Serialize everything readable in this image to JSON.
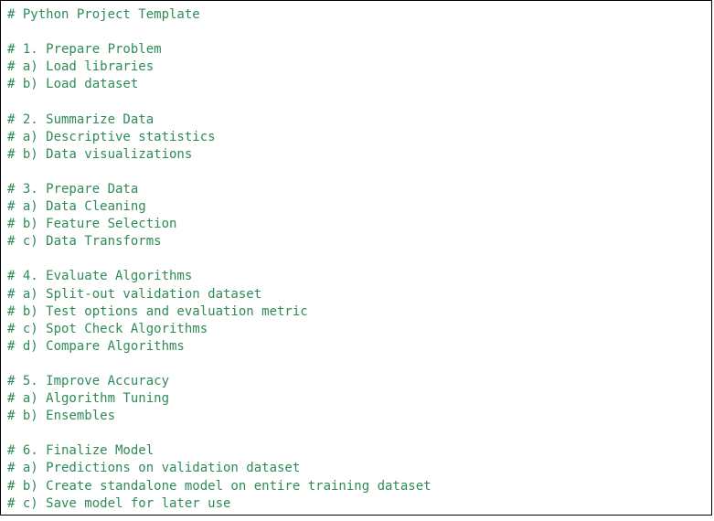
{
  "colors": {
    "comment_text": "#2e8b57",
    "border": "#000000",
    "background": "#ffffff"
  },
  "code_lines": [
    "# Python Project Template",
    "",
    "# 1. Prepare Problem",
    "# a) Load libraries",
    "# b) Load dataset",
    "",
    "# 2. Summarize Data",
    "# a) Descriptive statistics",
    "# b) Data visualizations",
    "",
    "# 3. Prepare Data",
    "# a) Data Cleaning",
    "# b) Feature Selection",
    "# c) Data Transforms",
    "",
    "# 4. Evaluate Algorithms",
    "# a) Split-out validation dataset",
    "# b) Test options and evaluation metric",
    "# c) Spot Check Algorithms",
    "# d) Compare Algorithms",
    "",
    "# 5. Improve Accuracy",
    "# a) Algorithm Tuning",
    "# b) Ensembles",
    "",
    "# 6. Finalize Model",
    "# a) Predictions on validation dataset",
    "# b) Create standalone model on entire training dataset",
    "# c) Save model for later use"
  ]
}
